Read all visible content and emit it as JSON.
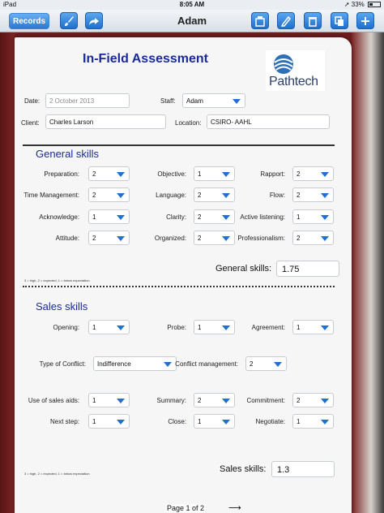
{
  "status": {
    "device": "iPad",
    "time": "8:05 AM",
    "battery": "33%"
  },
  "nav": {
    "records": "Records",
    "title": "Adam"
  },
  "icons": {
    "brush": "paintbrush-icon",
    "share": "share-icon",
    "folder": "folder-icon",
    "pen": "pen-icon",
    "trash": "trash-icon",
    "copy": "copy-icon",
    "add": "plus-icon"
  },
  "form": {
    "title": "In-Field Assessment",
    "logo_text": "Pathtech",
    "date_label": "Date:",
    "date_value": "2 October 2013",
    "staff_label": "Staff:",
    "staff_value": "Adam",
    "client_label": "Client:",
    "client_value": "Charles Larson",
    "location_label": "Location:",
    "location_value": "CSIRO- AAHL"
  },
  "general": {
    "heading": "General skills",
    "items": [
      {
        "label": "Preparation:",
        "value": "2"
      },
      {
        "label": "Objective:",
        "value": "1"
      },
      {
        "label": "Rapport:",
        "value": "2"
      },
      {
        "label": "Time Management:",
        "value": "2"
      },
      {
        "label": "Language:",
        "value": "2"
      },
      {
        "label": "Flow:",
        "value": "2"
      },
      {
        "label": "Acknowledge:",
        "value": "1"
      },
      {
        "label": "Clarity:",
        "value": "2"
      },
      {
        "label": "Active listening:",
        "value": "1"
      },
      {
        "label": "Attitude:",
        "value": "2"
      },
      {
        "label": "Organized:",
        "value": "2"
      },
      {
        "label": "Professionalism:",
        "value": "2"
      }
    ],
    "total_label": "General skills:",
    "total_value": "1.75",
    "footnote": "3 = high, 2 = expected, 1 = below expectation"
  },
  "sales": {
    "heading": "Sales skills",
    "opening_label": "Opening:",
    "opening_value": "1",
    "probe_label": "Probe:",
    "probe_value": "1",
    "agreement_label": "Agreement:",
    "agreement_value": "1",
    "conflict_type_label": "Type of Conflict:",
    "conflict_type_value": "Indifference",
    "conflict_mgmt_label": "Conflict management:",
    "conflict_mgmt_value": "2",
    "aids_label": "Use of sales aids:",
    "aids_value": "1",
    "summary_label": "Summary:",
    "summary_value": "2",
    "commitment_label": "Commitment:",
    "commitment_value": "2",
    "next_label": "Next step:",
    "next_value": "1",
    "close_label": "Close:",
    "close_value": "1",
    "negotiate_label": "Negotiate:",
    "negotiate_value": "1",
    "total_label": "Sales skills:",
    "total_value": "1.3",
    "footnote": "3 = high, 2 = expected, 1 = below expectation"
  },
  "pager": {
    "label": "Page 1 of 2",
    "arrow": "⟶"
  }
}
